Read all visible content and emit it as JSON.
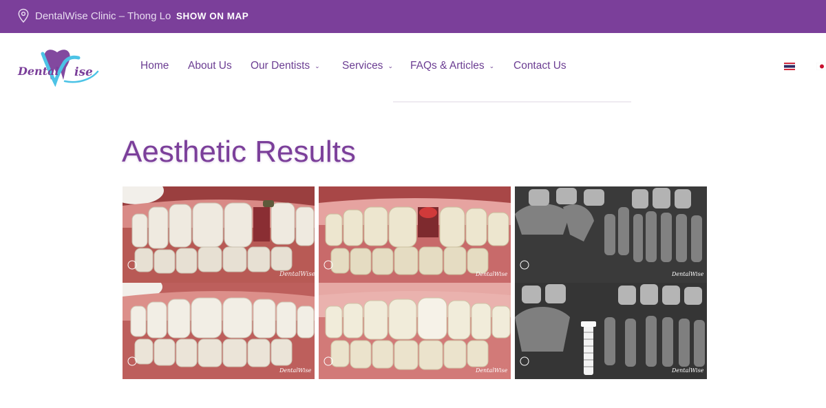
{
  "topbar": {
    "location_text": "DentalWise Clinic – Thong Lo",
    "map_link": "SHOW ON MAP",
    "icon": "location-pin-icon",
    "bg_color": "#7b3f9a"
  },
  "header": {
    "logo_text_left": "Dental",
    "logo_text_right": "ise",
    "nav": [
      {
        "label": "Home",
        "has_dropdown": false
      },
      {
        "label": "About Us",
        "has_dropdown": false
      },
      {
        "label": "Our Dentists",
        "has_dropdown": true
      },
      {
        "label": "Services",
        "has_dropdown": true
      },
      {
        "label": "FAQs & Articles",
        "has_dropdown": true
      },
      {
        "label": "Contact Us",
        "has_dropdown": false
      }
    ],
    "languages": [
      "thai-flag-icon",
      "japan-flag-icon"
    ]
  },
  "main": {
    "title": "Aesthetic Results",
    "watermark": "DentalWise",
    "gallery": [
      {
        "before": "teeth-missing-tooth-photo",
        "after": "teeth-restored-photo"
      },
      {
        "before": "teeth-gap-photo",
        "after": "teeth-crown-photo"
      },
      {
        "before": "xray-before-photo",
        "after": "xray-implant-photo"
      }
    ]
  },
  "colors": {
    "brand": "#7b3f9a",
    "nav_text": "#6b3d92",
    "logo_blue": "#4cc3e6"
  }
}
